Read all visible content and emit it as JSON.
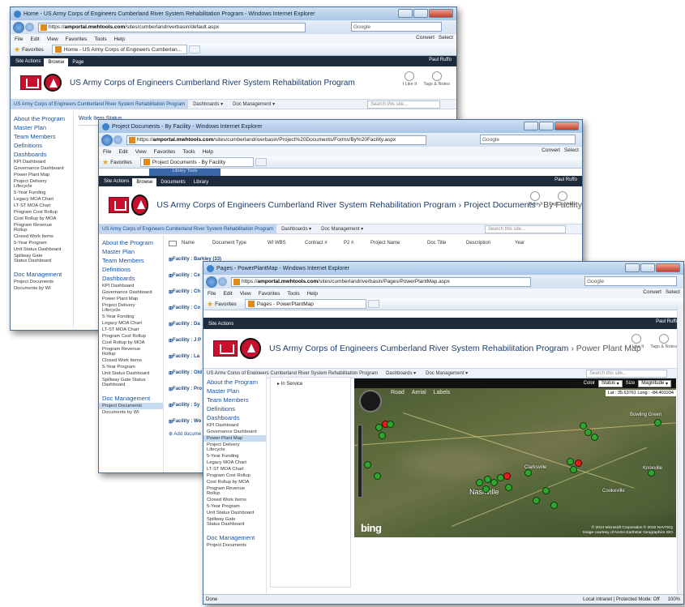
{
  "windows": {
    "back": {
      "title": "Home - US Army Corps of Engineers Cumberland River System Rehabilitation Program - Windows Internet Explorer",
      "url_prefix": "https://",
      "url_host": "amportal.mwhtools.com",
      "url_path": "/sites/cumberlandriverbasin/default.aspx",
      "search_engine": "Google",
      "menu": [
        "File",
        "Edit",
        "View",
        "Favorites",
        "Tools",
        "Help"
      ],
      "favorites_label": "Favorites",
      "tab_label": "Home - US Army Corps of Engineers Cumberlan...",
      "convert_label": "Convert",
      "select_label": "Select",
      "site_actions": "Site Actions",
      "ribbon_tabs": [
        "Browse",
        "Page"
      ],
      "user": "Paul Ruffo",
      "site_title": "US Army Corps of Engineers Cumberland River System Rehabilitation Program",
      "like_label": "I Like It",
      "tags_label": "Tags & Notes",
      "home_nav": "US Army Corps of Engineers Cumberland River System Rehabilitation Program",
      "nav_items": [
        "Dashboards",
        "Doc Management"
      ],
      "search_placeholder": "Search this site...",
      "webpart_title": "Work Item Status"
    },
    "mid": {
      "title": "Project Documents - By Facility - Windows Internet Explorer",
      "url_prefix": "https://",
      "url_host": "amportal.mwhtools.com",
      "url_path": "/sites/cumberlandriverbasin/Project%20Documents/Forms/By%20Facility.aspx",
      "search_engine": "Google",
      "menu": [
        "File",
        "Edit",
        "View",
        "Favorites",
        "Tools",
        "Help"
      ],
      "favorites_label": "Favorites",
      "tab_label": "Project Documents - By Facility",
      "convert_label": "Convert",
      "select_label": "Select",
      "site_actions": "Site Actions",
      "library_tools": "Library Tools",
      "ribbon_tabs": [
        "Browse",
        "Documents",
        "Library"
      ],
      "user": "Paul Ruffo",
      "site_title": "US Army Corps of Engineers Cumberland River System Rehabilitation Program",
      "crumb_1": "Project Documents",
      "crumb_2": "By Facility",
      "like_label": "I Like It",
      "tags_label": "Tags & Notes",
      "home_nav": "US Army Corps of Engineers Cumberland River System Rehabilitation Program",
      "nav_items": [
        "Dashboards",
        "Doc Management"
      ],
      "search_placeholder": "Search this site...",
      "columns": [
        "Name",
        "Document Type",
        "WI WBS",
        "Contract #",
        "P2 #",
        "Project Name",
        "Doc Title",
        "Description",
        "Year"
      ],
      "facilities": [
        "Facility : Barkley (33)",
        "Facility : Ce",
        "Facility : Ch",
        "Facility : Co",
        "Facility : Da",
        "Facility : J P",
        "Facility : La",
        "Facility : Old",
        "Facility : Pro",
        "Facility : Sy",
        "Facility : Wo"
      ],
      "add_document": "Add docume"
    },
    "front": {
      "title": "Pages - PowerPlantMap - Windows Internet Explorer",
      "url_prefix": "https://",
      "url_host": "amportal.mwhtools.com",
      "url_path": "/sites/cumberlandriverbasin/Pages/PowerPlantMap.aspx",
      "search_engine": "Google",
      "menu": [
        "File",
        "Edit",
        "View",
        "Favorites",
        "Tools",
        "Help"
      ],
      "favorites_label": "Favorites",
      "tab_label": "Pages - PowerPlantMap",
      "convert_label": "Convert",
      "select_label": "Select",
      "site_actions": "Site Actions",
      "user": "Paul Ruffo",
      "site_title": "US Army Corps of Engineers Cumberland River System Rehabilitation Program",
      "crumb": "Power Plant Map",
      "like_label": "I Like It",
      "tags_label": "Tags & Notes",
      "home_nav": "US Army Corps of Engineers Cumberland River System Rehabilitation Program",
      "nav_items": [
        "Dashboards",
        "Doc Management"
      ],
      "search_placeholder": "Search this site...",
      "legend_item": "In Service",
      "map_toolbar": [
        "Road",
        "Aerial",
        "Labels"
      ],
      "color_label": "Color",
      "color_value": "Status",
      "size_label": "Size",
      "size_value": "Magnitude",
      "lat_long": "Lat : 35.63761  Long : -84.401934",
      "bing": "bing",
      "copyright_1": "© 2014 Microsoft Corporation  © 2010 NAVTEQ",
      "copyright_2": "Image courtesy of NASA   Earthstar Geographics SIO",
      "map_places": [
        "Nashville",
        "Clarksville",
        "Knoxville",
        "Cookeville",
        "Bowling Green"
      ],
      "status_done": "Done",
      "status_zone": "Local intranet | Protected Mode: Off",
      "zoom": "100%"
    }
  },
  "quick_launch": [
    {
      "label": "About the Program",
      "type": "h"
    },
    {
      "label": "Master Plan",
      "type": "h"
    },
    {
      "label": "Team Members",
      "type": "h"
    },
    {
      "label": "Definitions",
      "type": "h"
    },
    {
      "label": "Dashboards",
      "type": "h"
    },
    {
      "label": "KPI Dashboard",
      "type": "s"
    },
    {
      "label": "Governance Dashboard",
      "type": "s"
    },
    {
      "label": "Power Plant Map",
      "type": "s"
    },
    {
      "label": "Project Delivery Lifecycle",
      "type": "s"
    },
    {
      "label": "5-Year Funding",
      "type": "s"
    },
    {
      "label": "Legacy MOA Chart",
      "type": "s"
    },
    {
      "label": "LT-ST MOA Chart",
      "type": "s"
    },
    {
      "label": "Program Cost Rollup",
      "type": "s"
    },
    {
      "label": "Cost Rollup by MOA",
      "type": "s"
    },
    {
      "label": "Program Revenue Rollup",
      "type": "s"
    },
    {
      "label": "Closed Work Items",
      "type": "s"
    },
    {
      "label": "5-Year Program",
      "type": "s"
    },
    {
      "label": "Unit Status Dashboard",
      "type": "s"
    },
    {
      "label": "Spillway Gate Status Dashboard",
      "type": "s"
    },
    {
      "label": "Doc Management",
      "type": "h"
    },
    {
      "label": "Project Documents",
      "type": "s"
    },
    {
      "label": "Documents by WI",
      "type": "s"
    }
  ],
  "colors": {
    "status_in_service": "#2fa52f",
    "status_out_of_service": "#e02020",
    "nav_link": "#1753a8"
  }
}
